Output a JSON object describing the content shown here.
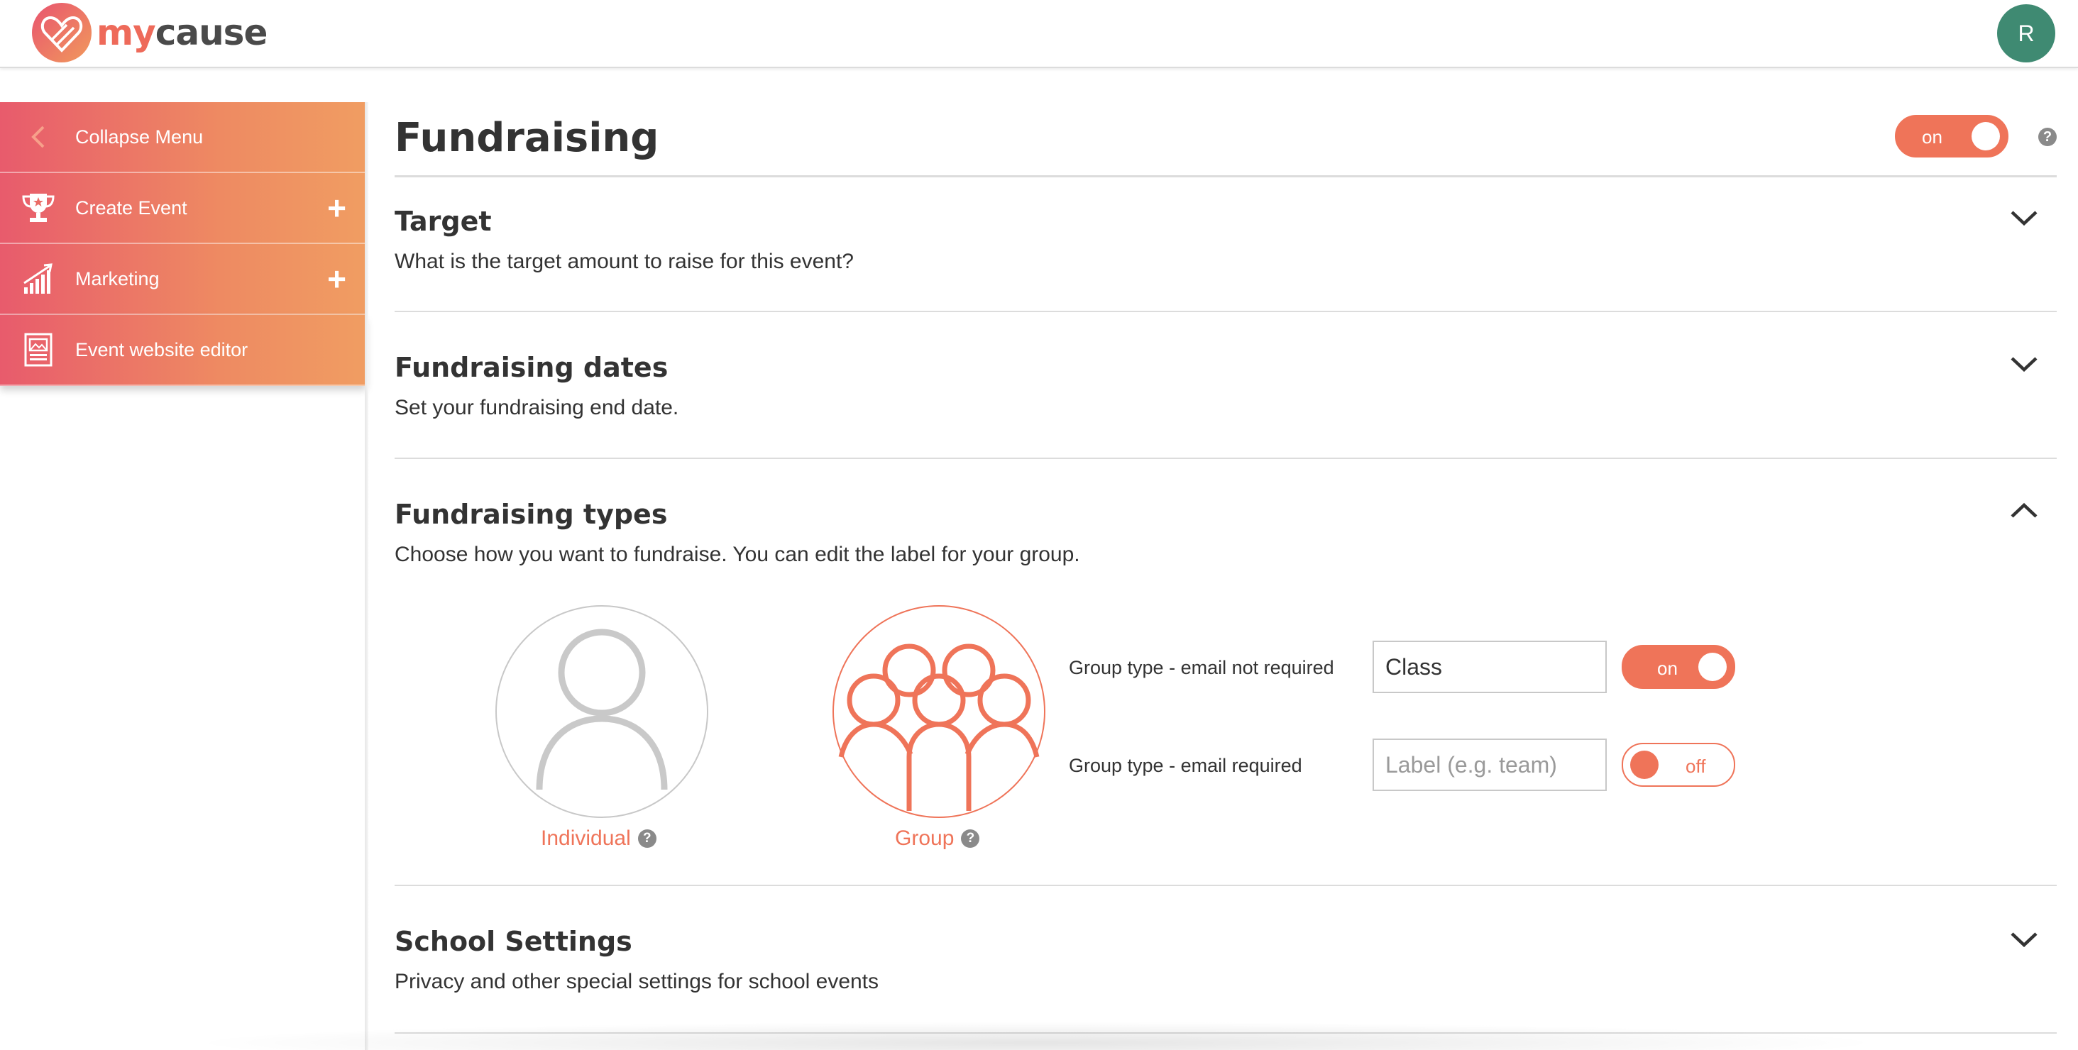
{
  "app": {
    "logo_my": "my",
    "logo_cause": "cause",
    "user_initial": "R",
    "brand_color": "#ef7459",
    "avatar_color": "#3f8a72"
  },
  "sidebar": {
    "items": [
      {
        "label": "Collapse Menu",
        "icon": "chevron-left-icon"
      },
      {
        "label": "Create Event",
        "icon": "trophy-icon",
        "action": "+"
      },
      {
        "label": "Marketing",
        "icon": "growth-chart-icon",
        "action": "+"
      },
      {
        "label": "Event website editor",
        "icon": "website-editor-icon"
      }
    ]
  },
  "page": {
    "title": "Fundraising",
    "toggle_label": "on",
    "help": "?"
  },
  "sections": {
    "target": {
      "title": "Target",
      "description": "What is the target amount to raise for this event?",
      "expanded": false
    },
    "dates": {
      "title": "Fundraising dates",
      "description": "Set your fundraising end date.",
      "expanded": false
    },
    "types": {
      "title": "Fundraising types",
      "description": "Choose how you want to fundraise. You can edit the label for your group.",
      "expanded": true,
      "individual_label": "Individual",
      "group_label": "Group",
      "help": "?",
      "rows": [
        {
          "label": "Group type - email not required",
          "value": "Class",
          "placeholder": "",
          "toggle": "on"
        },
        {
          "label": "Group type - email required",
          "value": "",
          "placeholder": "Label (e.g. team)",
          "toggle": "off"
        }
      ]
    },
    "school": {
      "title": "School Settings",
      "description": "Privacy and other special settings for school events",
      "expanded": false
    }
  }
}
